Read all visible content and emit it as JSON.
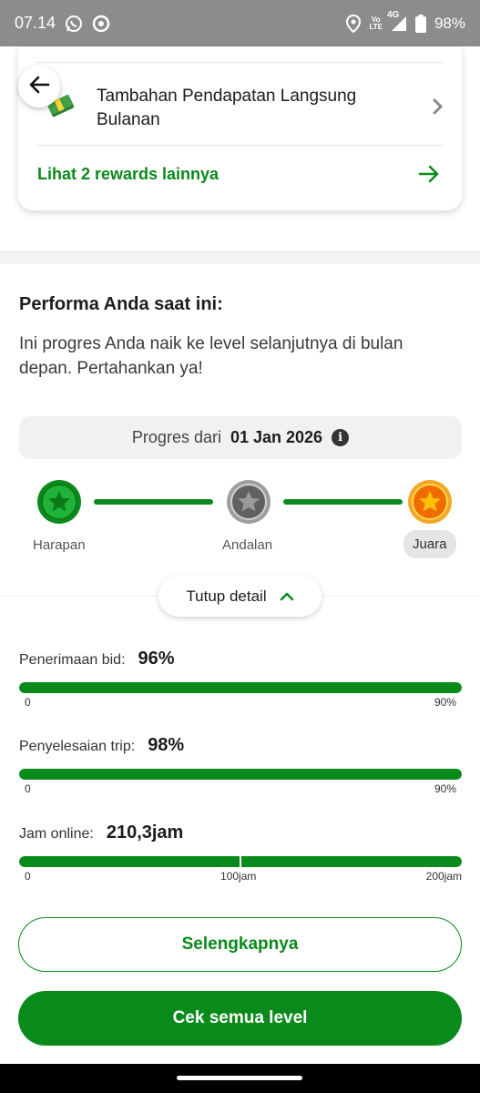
{
  "status_bar": {
    "time": "07.14",
    "volte_top": "Vo",
    "volte_bottom": "LTE",
    "network": "4G",
    "battery": "98%",
    "icons": [
      "whatsapp-icon",
      "app-icon",
      "location-icon",
      "signal-icon",
      "battery-icon"
    ]
  },
  "reward_card": {
    "item_label": "Tambahan Pendapatan Langsung Bulanan",
    "more_link": "Lihat 2 rewards lainnya",
    "item_icon": "cash-icon"
  },
  "performance": {
    "title": "Performa Anda saat ini:",
    "description": "Ini progres Anda naik ke level selanjutnya di bulan depan. Pertahankan ya!",
    "progress_label": "Progres dari",
    "progress_date": "01 Jan 2026",
    "levels": [
      {
        "name": "Harapan",
        "color": "#17a32b"
      },
      {
        "name": "Andalan",
        "color": "#6e6e6e"
      },
      {
        "name": "Juara",
        "color": "#f5a623"
      }
    ],
    "detail_toggle": "Tutup detail"
  },
  "metrics": [
    {
      "label": "Penerimaan bid:",
      "value": "96%",
      "fill": 1.0,
      "scale": [
        "0",
        "90%"
      ]
    },
    {
      "label": "Penyelesaian trip:",
      "value": "98%",
      "fill": 1.0,
      "scale": [
        "0",
        "90%"
      ]
    },
    {
      "label": "Jam online:",
      "value": "210,3jam",
      "fill": 1.0,
      "scale": [
        "0",
        "100jam",
        "200jam"
      ]
    }
  ],
  "buttons": {
    "details": "Selengkapnya",
    "all_levels": "Cek semua level"
  },
  "colors": {
    "accent": "#0a8a1a",
    "status_bar": "#8c8c8c"
  }
}
